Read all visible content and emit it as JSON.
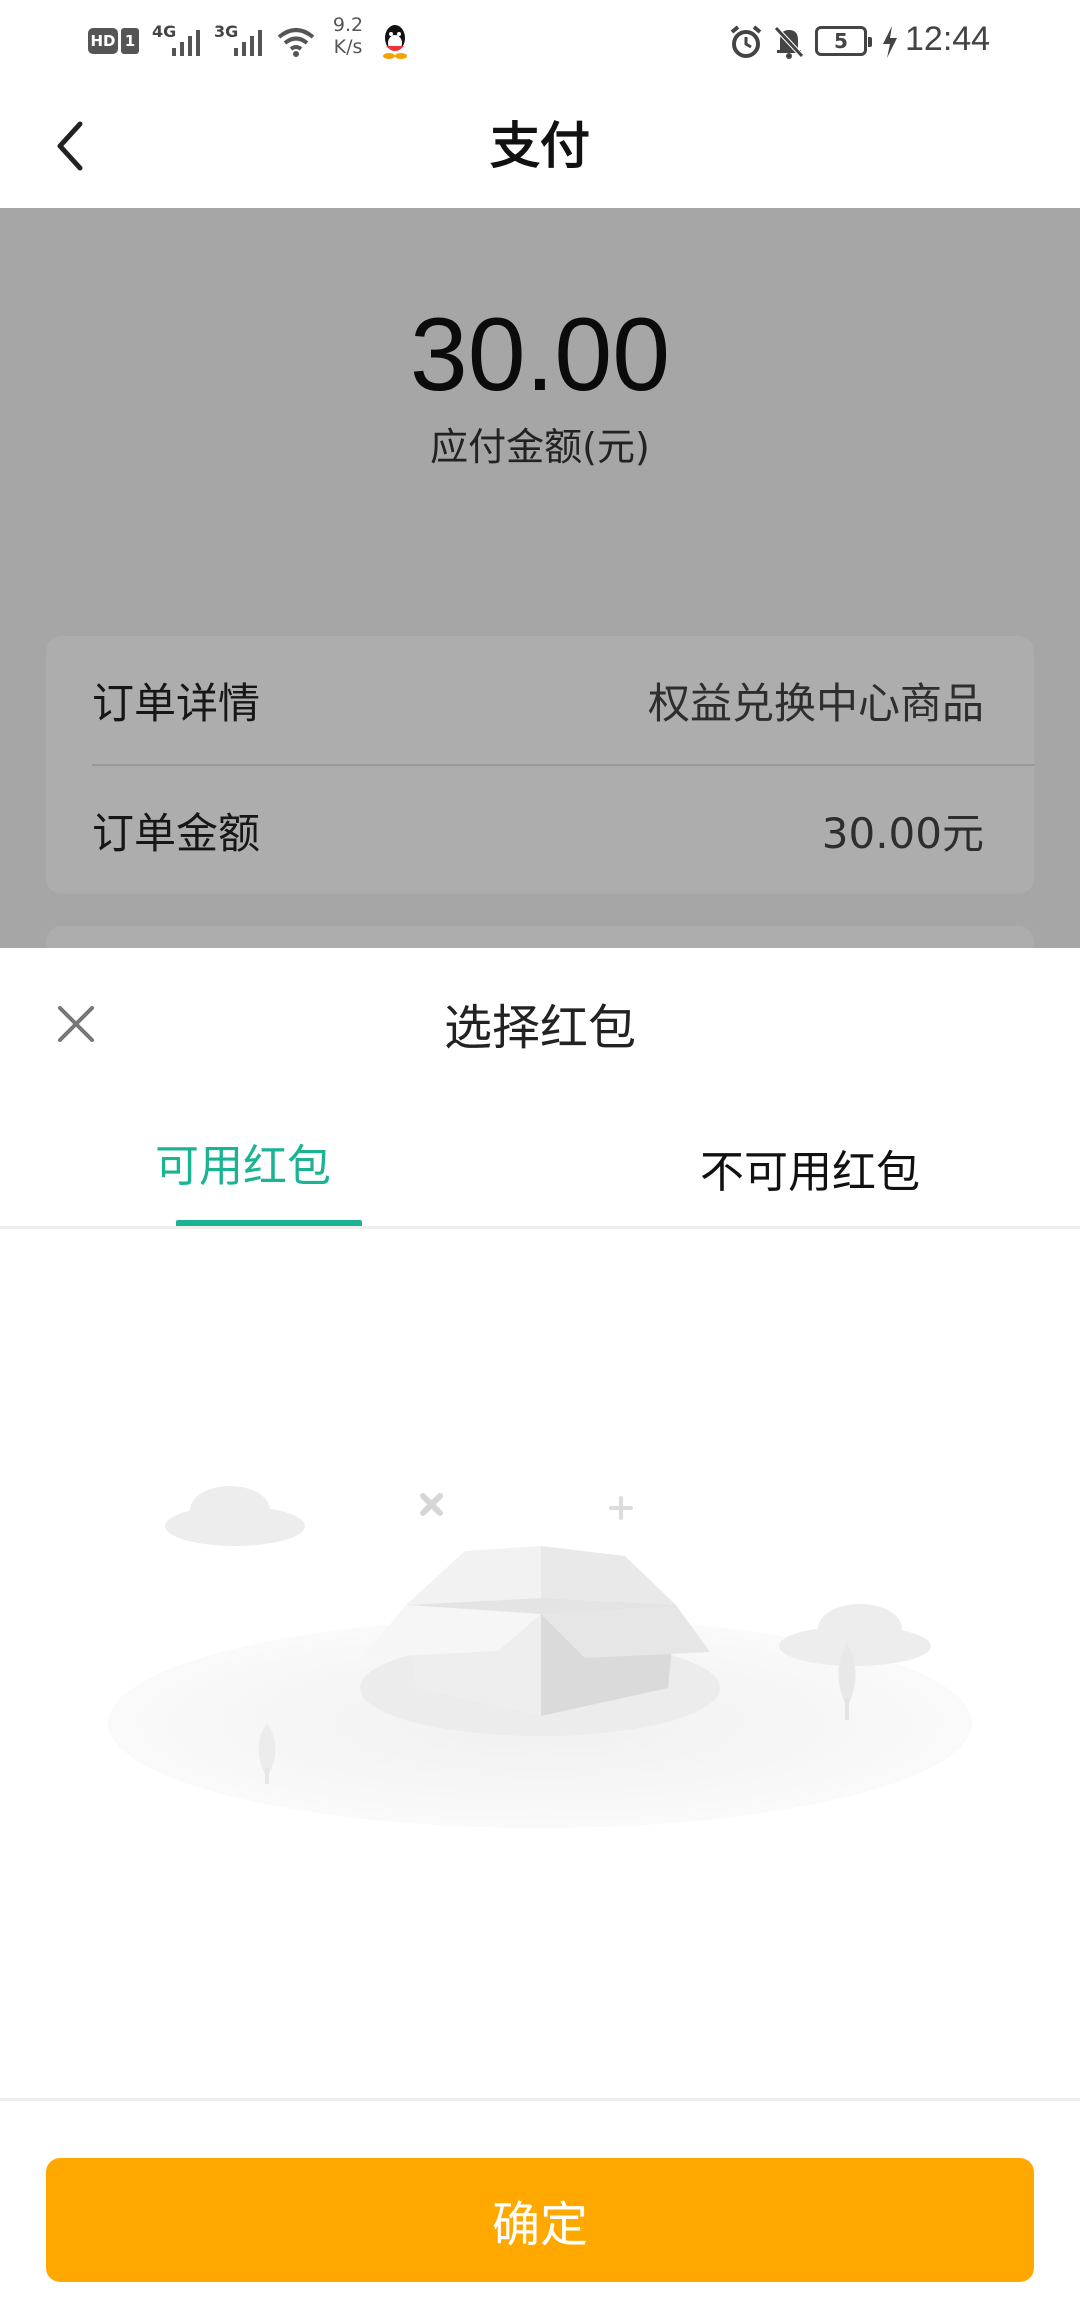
{
  "status_bar": {
    "hd": "HD",
    "sim": "1",
    "net1": "4G",
    "net2": "3G",
    "speed_value": "9.2",
    "speed_unit": "K/s",
    "battery": "5",
    "time": "12:44"
  },
  "header": {
    "title": "支付"
  },
  "payment": {
    "amount": "30.00",
    "amount_label": "应付金额(元)",
    "rows": [
      {
        "label": "订单详情",
        "value": "权益兑换中心商品"
      },
      {
        "label": "订单金额",
        "value": "30.00元"
      }
    ]
  },
  "sheet": {
    "title": "选择红包",
    "tabs": [
      {
        "label": "可用红包",
        "active": true
      },
      {
        "label": "不可用红包",
        "active": false
      }
    ],
    "confirm_label": "确定"
  },
  "colors": {
    "accent": "#1bb492",
    "button": "#ffa800"
  },
  "icons": [
    "back-arrow-icon",
    "close-icon",
    "empty-box-illustration"
  ]
}
